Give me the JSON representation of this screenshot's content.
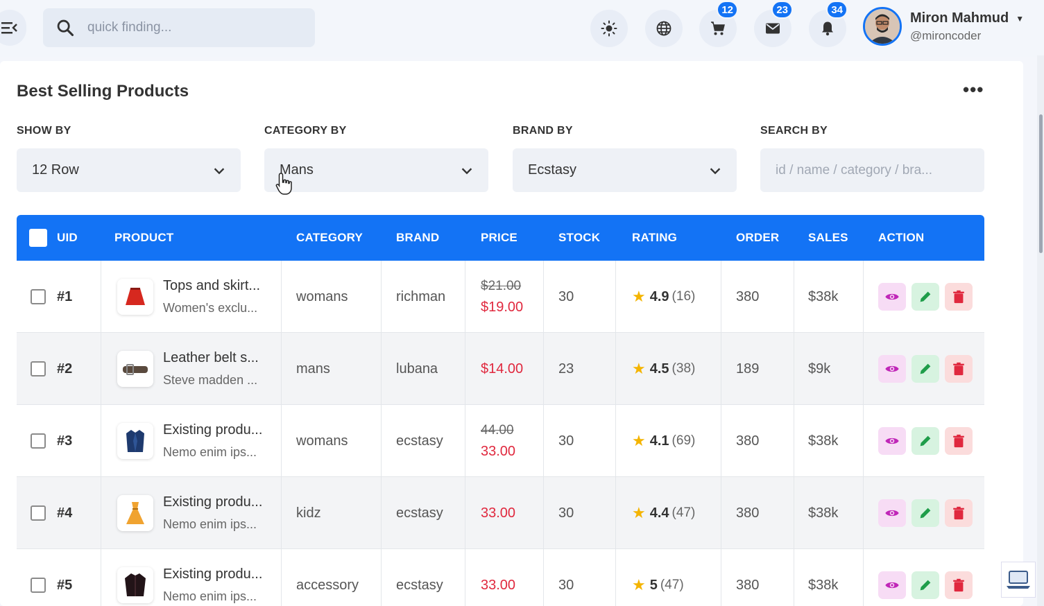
{
  "header": {
    "search_placeholder": "quick finding...",
    "cart_badge": "12",
    "mail_badge": "23",
    "notif_badge": "34",
    "user_name": "Miron Mahmud",
    "user_handle": "@mironcoder"
  },
  "card": {
    "title": "Best Selling Products",
    "more": "•••"
  },
  "filters": {
    "show_label": "SHOW BY",
    "show_value": "12 Row",
    "category_label": "CATEGORY BY",
    "category_value": "Mans",
    "brand_label": "BRAND BY",
    "brand_value": "Ecstasy",
    "search_label": "SEARCH BY",
    "search_placeholder": "id / name / category / bra..."
  },
  "table": {
    "headers": [
      "UID",
      "PRODUCT",
      "CATEGORY",
      "BRAND",
      "PRICE",
      "STOCK",
      "RATING",
      "ORDER",
      "SALES",
      "ACTION"
    ],
    "rows": [
      {
        "uid": "#1",
        "title": "Tops and skirt...",
        "sub": "Women's exclu...",
        "category": "womans",
        "brand": "richman",
        "old_price": "$21.00",
        "price": "$19.00",
        "stock": "30",
        "rating": "4.9",
        "rating_count": "(16)",
        "order": "380",
        "sales": "$38k",
        "thumb_icon": "skirt-icon"
      },
      {
        "uid": "#2",
        "title": "Leather belt s...",
        "sub": "Steve madden ...",
        "category": "mans",
        "brand": "lubana",
        "old_price": "",
        "price": "$14.00",
        "stock": "23",
        "rating": "4.5",
        "rating_count": "(38)",
        "order": "189",
        "sales": "$9k",
        "thumb_icon": "belt-icon"
      },
      {
        "uid": "#3",
        "title": "Existing produ...",
        "sub": "Nemo enim ips...",
        "category": "womans",
        "brand": "ecstasy",
        "old_price": "44.00",
        "price": "33.00",
        "stock": "30",
        "rating": "4.1",
        "rating_count": "(69)",
        "order": "380",
        "sales": "$38k",
        "thumb_icon": "blazer-icon"
      },
      {
        "uid": "#4",
        "title": "Existing produ...",
        "sub": "Nemo enim ips...",
        "category": "kidz",
        "brand": "ecstasy",
        "old_price": "",
        "price": "33.00",
        "stock": "30",
        "rating": "4.4",
        "rating_count": "(47)",
        "order": "380",
        "sales": "$38k",
        "thumb_icon": "dress-icon"
      },
      {
        "uid": "#5",
        "title": "Existing produ...",
        "sub": "Nemo enim ips...",
        "category": "accessory",
        "brand": "ecstasy",
        "old_price": "",
        "price": "33.00",
        "stock": "30",
        "rating": "5",
        "rating_count": "(47)",
        "order": "380",
        "sales": "$38k",
        "thumb_icon": "jacket-icon"
      }
    ]
  },
  "colors": {
    "accent": "#1373f5",
    "price_red": "#e0283e",
    "star": "#f4b400",
    "view": "#c026b8",
    "edit": "#1f9d4a",
    "delete": "#e0283e"
  }
}
